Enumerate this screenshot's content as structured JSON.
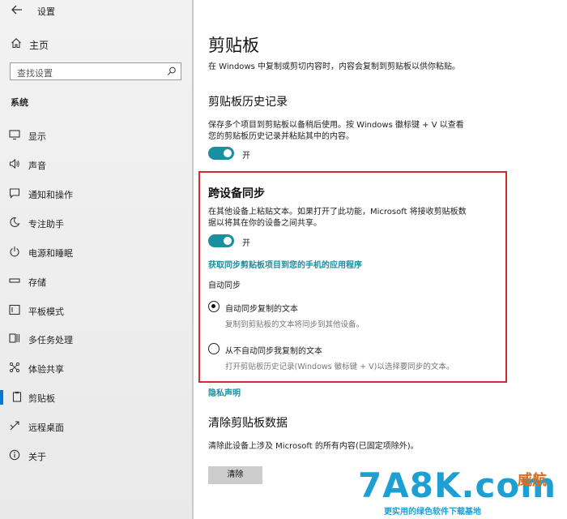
{
  "app": {
    "title": "设置"
  },
  "sidebar": {
    "home_label": "主页",
    "search_placeholder": "查找设置",
    "section": "系统",
    "items": [
      {
        "label": "显示",
        "icon": "display-icon"
      },
      {
        "label": "声音",
        "icon": "speaker-icon"
      },
      {
        "label": "通知和操作",
        "icon": "notification-icon"
      },
      {
        "label": "专注助手",
        "icon": "moon-icon"
      },
      {
        "label": "电源和睡眠",
        "icon": "power-icon"
      },
      {
        "label": "存储",
        "icon": "storage-icon"
      },
      {
        "label": "平板模式",
        "icon": "tablet-icon"
      },
      {
        "label": "多任务处理",
        "icon": "multitask-icon"
      },
      {
        "label": "体验共享",
        "icon": "share-icon"
      },
      {
        "label": "剪贴板",
        "icon": "clipboard-icon",
        "active": true
      },
      {
        "label": "远程桌面",
        "icon": "remote-desktop-icon"
      },
      {
        "label": "关于",
        "icon": "info-icon"
      }
    ]
  },
  "main": {
    "title": "剪贴板",
    "intro": "在 Windows 中复制或剪切内容时，内容会复制到剪贴板以供你粘贴。",
    "history": {
      "heading": "剪贴板历史记录",
      "desc_line1": "保存多个项目到剪贴板以备稍后使用。按 Windows 徽标键 + V 以查看",
      "desc_line2": "您的剪贴板历史记录并粘贴其中的内容。",
      "toggle_label": "开",
      "toggle_on": true
    },
    "sync": {
      "heading": "跨设备同步",
      "desc_line1": "在其他设备上粘贴文本。如果打开了此功能，Microsoft 将接收剪贴板数",
      "desc_line2": "据以将其在你的设备之间共享。",
      "toggle_label": "开",
      "toggle_on": true,
      "link": "获取同步剪贴板项目到您的手机的应用程序",
      "auto_sync_label": "自动同步",
      "option1_label": "自动同步复制的文本",
      "option1_desc": "复制到剪贴板的文本将同步到其他设备。",
      "option2_label": "从不自动同步我复制的文本",
      "option2_desc": "打开剪贴板历史记录(Windows 徽标键 + V)以选择要同步的文本。",
      "selected": "option1"
    },
    "privacy_link": "隐私声明",
    "clear": {
      "heading": "清除剪贴板数据",
      "desc": "清除此设备上涉及 Microsoft 的所有内容(已固定项除外)。",
      "button": "清除"
    }
  },
  "watermark": {
    "main": "7A8K.com",
    "small": "威航",
    "tagline": "更实用的绿色软件下载基地"
  },
  "colors": {
    "accent": "#1a8fa0",
    "nav_active": "#0078d7",
    "highlight_box": "#d62b2b"
  }
}
